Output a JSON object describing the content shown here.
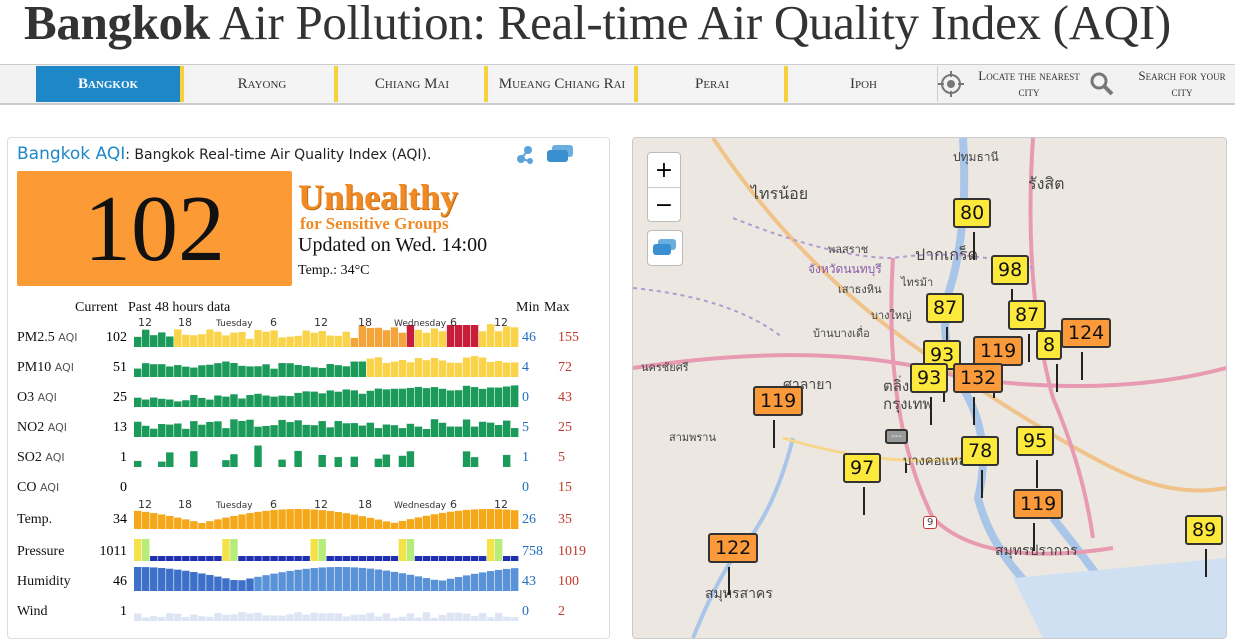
{
  "page": {
    "title_bold": "Bangkok",
    "title_rest": " Air Pollution: Real-time Air Quality Index (AQI)"
  },
  "nav": {
    "tabs": [
      {
        "label": "Bangkok",
        "active": true
      },
      {
        "label": "Rayong"
      },
      {
        "label": "Chiang Mai"
      },
      {
        "label": "Mueang Chiang Rai"
      },
      {
        "label": "Perai"
      },
      {
        "label": "Ipoh"
      }
    ],
    "locate": "Locate the nearest city",
    "search": "Search for your city"
  },
  "panel": {
    "city_label": "Bangkok AQI",
    "subtitle": ": Bangkok Real-time Air Quality Index (AQI).",
    "aqi": "102",
    "status_main": "Unhealthy",
    "status_sub": "for Sensitive Groups",
    "updated": "Updated on Wed. 14:00",
    "temp": "Temp.: 34°C",
    "col_current": "Current",
    "col_history": "Past 48 hours data",
    "col_min": "Min",
    "col_max": "Max",
    "aqi_unit": "AQI",
    "colors": {
      "aqi_box": "#fc9b35",
      "status": "#f08a24"
    }
  },
  "chart_data": {
    "type": "bar",
    "time_ticks": [
      "12",
      "18",
      "Tuesday",
      "6",
      "12",
      "18",
      "Wednesday",
      "6",
      "12"
    ],
    "rows": [
      {
        "name": "PM2.5",
        "aqi": true,
        "current": "102",
        "min": "46",
        "max": "155"
      },
      {
        "name": "PM10",
        "aqi": true,
        "current": "51",
        "min": "4",
        "max": "72"
      },
      {
        "name": "O3",
        "aqi": true,
        "current": "25",
        "min": "0",
        "max": "43"
      },
      {
        "name": "NO2",
        "aqi": true,
        "current": "13",
        "min": "5",
        "max": "25"
      },
      {
        "name": "SO2",
        "aqi": true,
        "current": "1",
        "min": "1",
        "max": "5"
      },
      {
        "name": "CO",
        "aqi": true,
        "current": "0",
        "min": "0",
        "max": "15"
      },
      {
        "name": "Temp.",
        "aqi": false,
        "current": "34",
        "min": "26",
        "max": "35"
      },
      {
        "name": "Pressure",
        "aqi": false,
        "current": "1011",
        "min": "758",
        "max": "1019"
      },
      {
        "name": "Humidity",
        "aqi": false,
        "current": "46",
        "min": "43",
        "max": "100"
      },
      {
        "name": "Wind",
        "aqi": false,
        "current": "1",
        "min": "0",
        "max": "2"
      }
    ]
  },
  "map": {
    "zoom_in": "+",
    "zoom_out": "−",
    "markers": [
      {
        "value": "80",
        "level": "moderate"
      },
      {
        "value": "98",
        "level": "moderate"
      },
      {
        "value": "87",
        "level": "moderate"
      },
      {
        "value": "87",
        "level": "moderate"
      },
      {
        "value": "124",
        "level": "usg"
      },
      {
        "value": "93",
        "level": "moderate"
      },
      {
        "value": "119",
        "level": "usg"
      },
      {
        "value": "8",
        "level": "moderate"
      },
      {
        "value": "93",
        "level": "moderate"
      },
      {
        "value": "132",
        "level": "usg"
      },
      {
        "value": "119",
        "level": "usg"
      },
      {
        "value": "---",
        "level": "none"
      },
      {
        "value": "95",
        "level": "moderate"
      },
      {
        "value": "78",
        "level": "moderate"
      },
      {
        "value": "97",
        "level": "moderate"
      },
      {
        "value": "119",
        "level": "usg"
      },
      {
        "value": "122",
        "level": "usg"
      },
      {
        "value": "89",
        "level": "moderate"
      }
    ],
    "labels": [
      "ปทุมธานี",
      "ไทรน้อย",
      "รังสิต",
      "ปากเกร็ด",
      "จังหวัดนนทบุรี",
      "พลสราช",
      "ไทรม้า",
      "เสาธงหิน",
      "บางใหญ่",
      "บ้านบางเดื่อ",
      "นครชัยศรี",
      "ศาลายา",
      "สามพราน",
      "ตลิ่ง",
      "กรุงเทพ",
      "บางคอแหลม",
      "สมุทรปราการ",
      "สมุทรสาคร",
      "9"
    ]
  }
}
